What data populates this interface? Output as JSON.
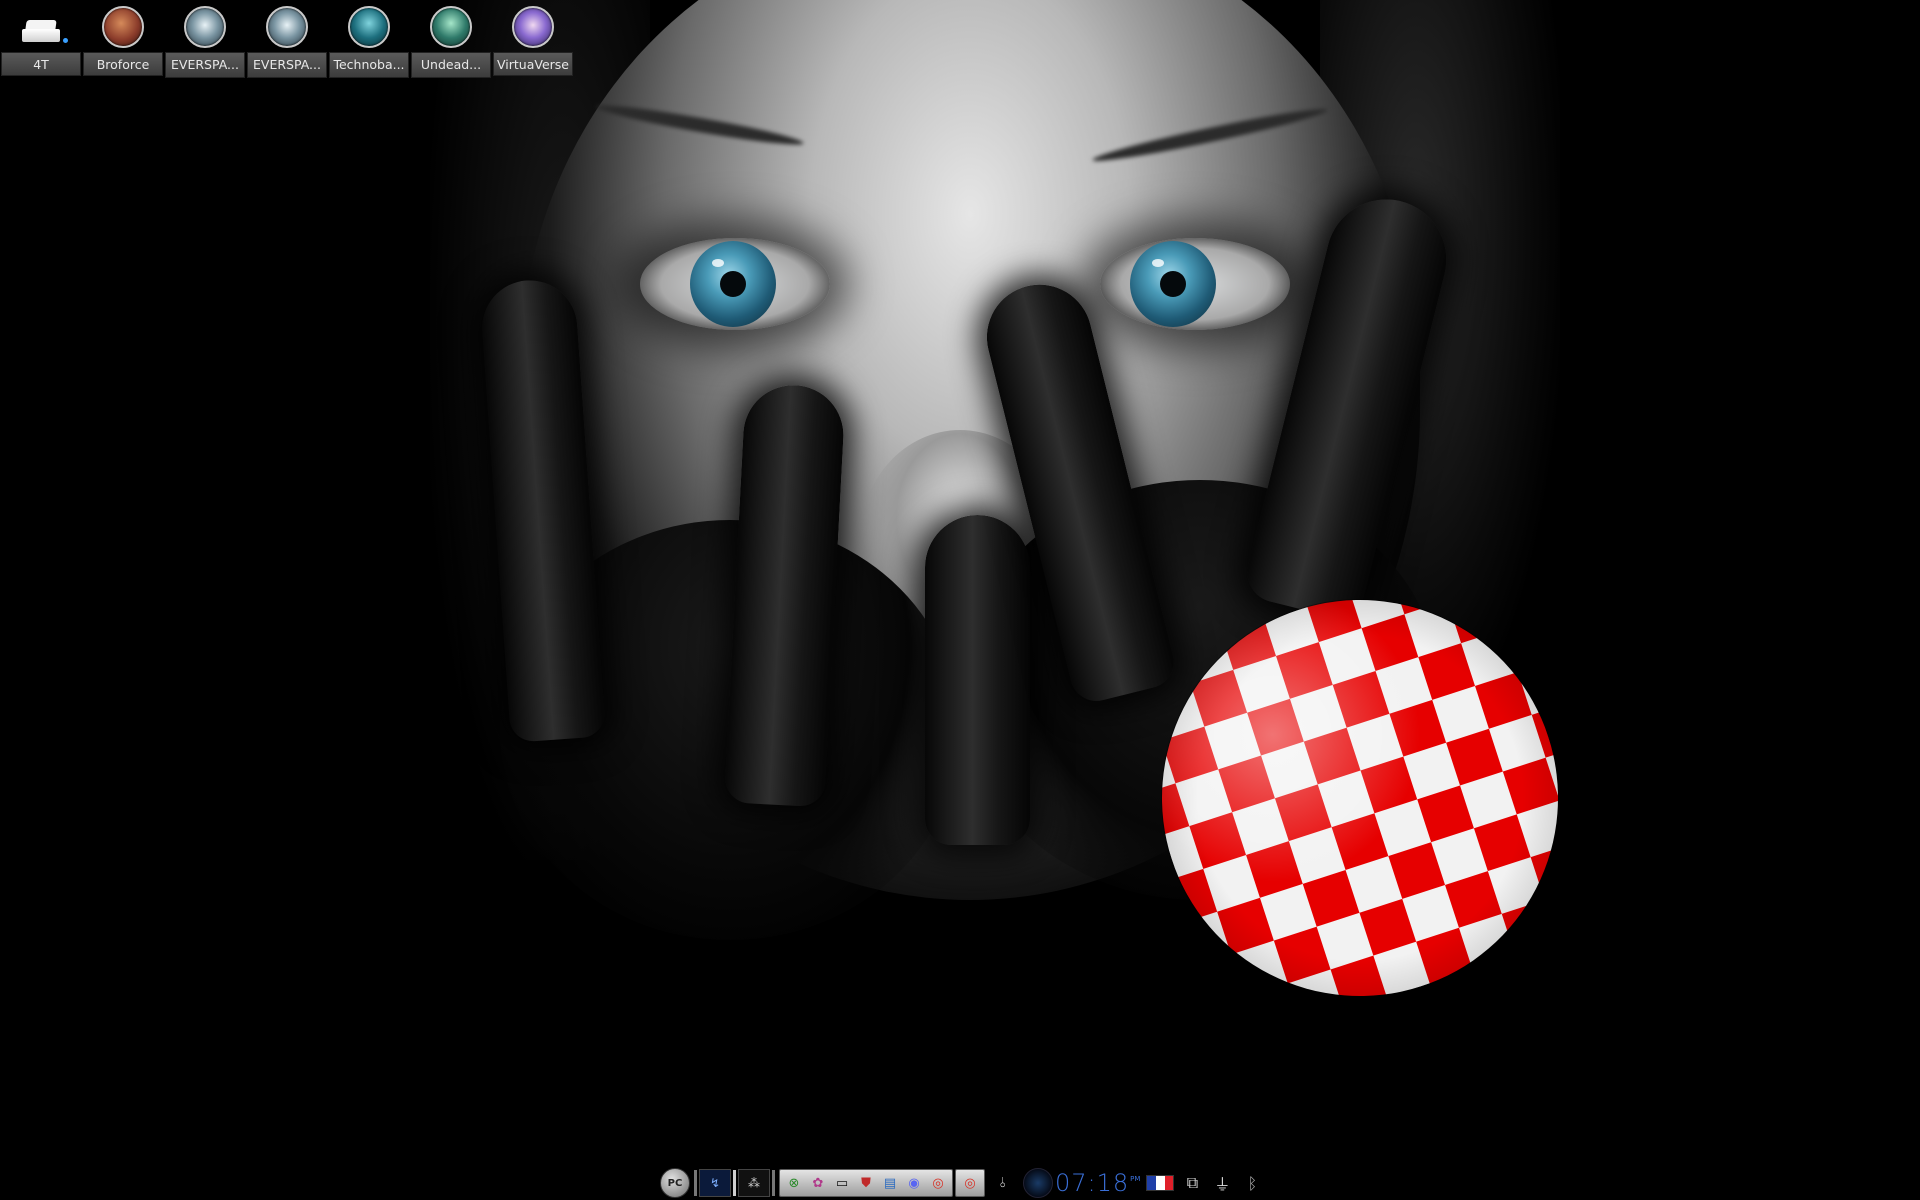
{
  "desktop": {
    "icons": [
      {
        "label": "4T",
        "icon": "hard-drive-icon"
      },
      {
        "label": "Broforce",
        "icon": "broforce-game-icon",
        "color": "#8a3b2a"
      },
      {
        "label": "EVERSPA...",
        "icon": "everspace-game-icon",
        "color": "#4b6878"
      },
      {
        "label": "EVERSPA...",
        "icon": "everspace-game-icon",
        "color": "#4b6878"
      },
      {
        "label": "Technoba...",
        "icon": "technobabylon-game-icon",
        "color": "#1d6f7e"
      },
      {
        "label": "Undead...",
        "icon": "undead-game-icon",
        "color": "#2f7a6a"
      },
      {
        "label": "VirtuaVerse",
        "icon": "virtuaverse-game-icon",
        "color": "#5a4a9a"
      }
    ]
  },
  "taskbar": {
    "start_label": "PC",
    "clock": {
      "time": "07:18",
      "ampm": "PM"
    },
    "language_colors": [
      "#1f3fa8",
      "#ffffff",
      "#e0202a"
    ],
    "apps": [
      {
        "icon": "xbox-icon",
        "glyph": "⊗"
      },
      {
        "icon": "palette-icon",
        "glyph": "✿"
      },
      {
        "icon": "computer-icon",
        "glyph": "▭"
      },
      {
        "icon": "shield-icon",
        "glyph": "⛊"
      },
      {
        "icon": "monitor-icon",
        "glyph": "▤"
      },
      {
        "icon": "discord-icon",
        "glyph": "◉"
      },
      {
        "icon": "chrome-icon",
        "glyph": "◎"
      }
    ],
    "single_app": {
      "icon": "chrome-icon",
      "glyph": "◎"
    },
    "windows": [
      {
        "icon": "window-blue-icon",
        "glyph": "↯"
      },
      {
        "icon": "window-dark-icon",
        "glyph": "⁂"
      }
    ]
  },
  "wallpaper": {
    "ball_colors": [
      "#e60000",
      "#f2f2f2"
    ]
  }
}
